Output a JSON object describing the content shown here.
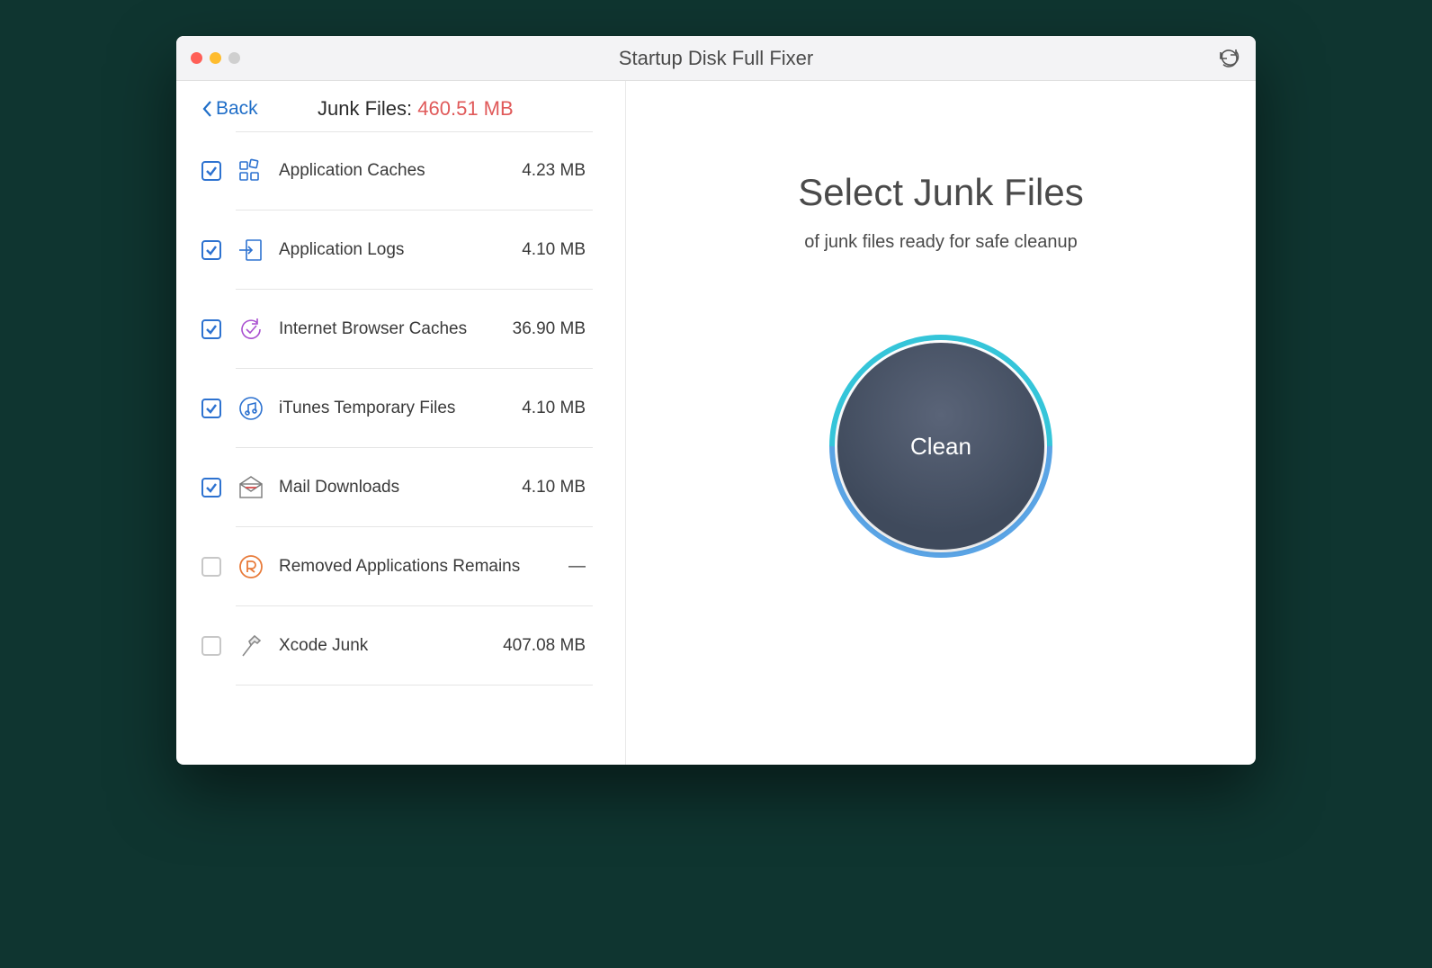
{
  "window": {
    "title_prefix": "Startup Disk Full",
    "title_strong": "Fixer"
  },
  "sidebar": {
    "back_label": "Back",
    "summary_label": "Junk Files:",
    "summary_amount": "460.51 MB"
  },
  "categories": [
    {
      "name": "Application Caches",
      "size": "4.23 MB",
      "checked": true,
      "icon": "grid"
    },
    {
      "name": "Application Logs",
      "size": "4.10 MB",
      "checked": true,
      "icon": "log"
    },
    {
      "name": "Internet Browser Caches",
      "size": "36.90 MB",
      "checked": true,
      "icon": "refresh-check"
    },
    {
      "name": "iTunes Temporary Files",
      "size": "4.10 MB",
      "checked": true,
      "icon": "music"
    },
    {
      "name": "Mail Downloads",
      "size": "4.10 MB",
      "checked": true,
      "icon": "mail"
    },
    {
      "name": "Removed Applications Remains",
      "size": "—",
      "checked": false,
      "icon": "removed"
    },
    {
      "name": "Xcode Junk",
      "size": "407.08 MB",
      "checked": false,
      "icon": "hammer"
    }
  ],
  "main": {
    "title": "Select Junk Files",
    "subtitle": "of junk files ready for safe cleanup",
    "clean_label": "Clean"
  }
}
